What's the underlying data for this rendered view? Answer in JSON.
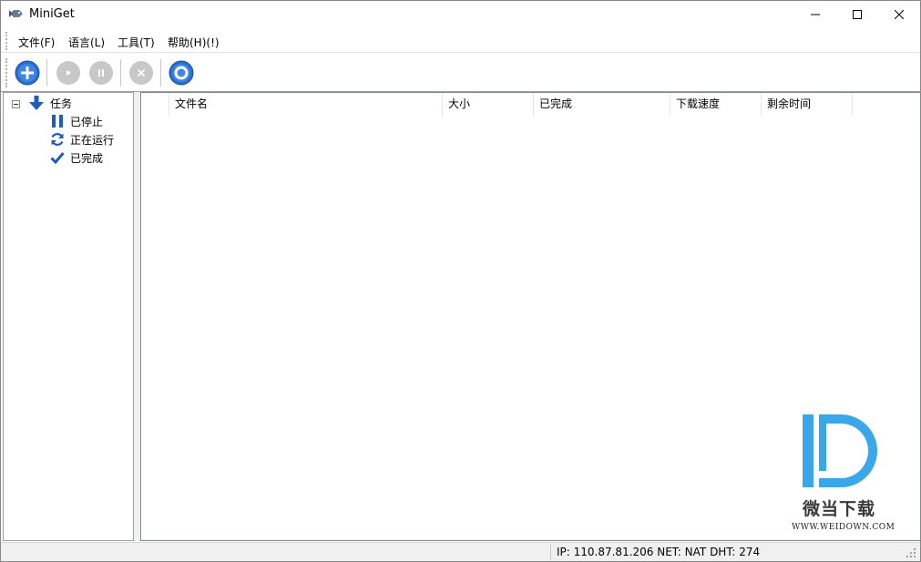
{
  "window": {
    "title": "MiniGet",
    "icon": "fish-app-icon"
  },
  "titlebar_buttons": [
    "minimize-icon",
    "maximize-icon",
    "close-icon"
  ],
  "menu": {
    "items": [
      {
        "label": "文件(F)"
      },
      {
        "label": "语言(L)"
      },
      {
        "label": "工具(T)"
      },
      {
        "label": "帮助(H)(!)"
      }
    ]
  },
  "toolbar": {
    "buttons": [
      {
        "name": "add-task",
        "icon": "plus-circle-icon",
        "enabled": true
      },
      {
        "name": "start",
        "icon": "play-icon",
        "enabled": false
      },
      {
        "name": "pause",
        "icon": "pause-icon",
        "enabled": false
      },
      {
        "name": "delete",
        "icon": "x-icon",
        "enabled": false
      },
      {
        "name": "settings",
        "icon": "gear-icon",
        "enabled": true
      }
    ]
  },
  "tree": {
    "root": {
      "label": "任务",
      "icon": "down-arrow-icon"
    },
    "children": [
      {
        "label": "已停止",
        "icon": "pause-icon"
      },
      {
        "label": "正在运行",
        "icon": "refresh-icon"
      },
      {
        "label": "已完成",
        "icon": "check-icon"
      }
    ]
  },
  "list": {
    "columns": [
      "文件名",
      "大小",
      "已完成",
      "下载速度",
      "剩余时间"
    ],
    "rows": []
  },
  "watermark": {
    "name": "微当下载",
    "url": "WWW.WEIDOWN.COM"
  },
  "status": {
    "text": "IP: 110.87.81.206 NET: NAT   DHT: 274"
  },
  "colors": {
    "accent_blue": "#2a6fd0",
    "icon_blue": "#1e5fb4",
    "watermark_blue": "#3aa7e8",
    "disabled_gray": "#c8c8c8"
  }
}
